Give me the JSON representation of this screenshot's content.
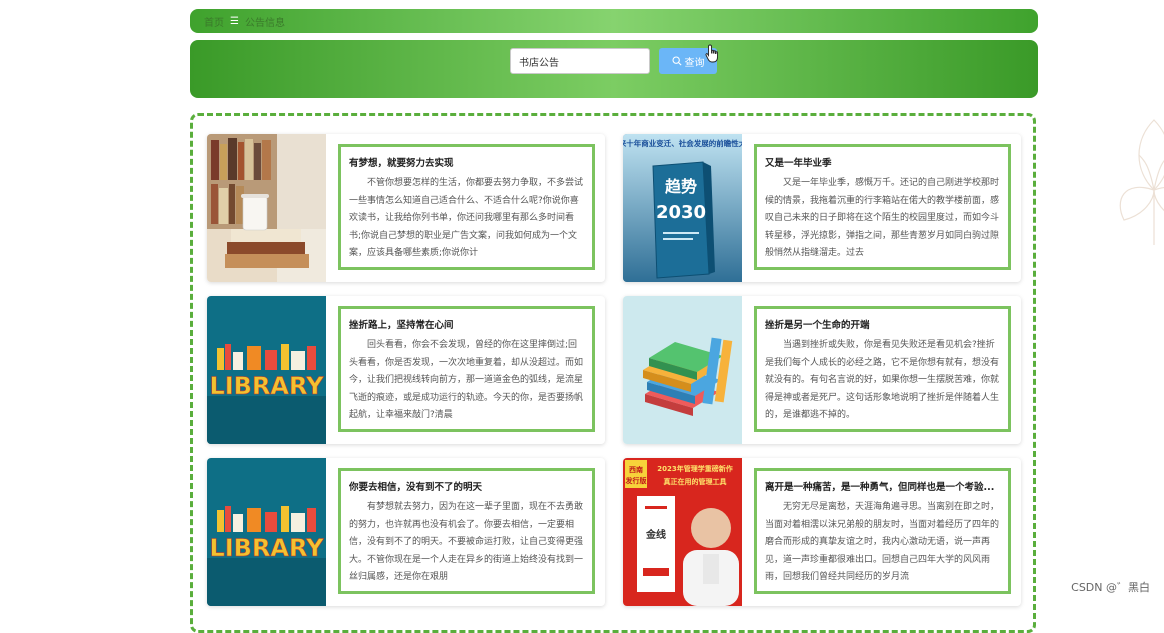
{
  "breadcrumb": {
    "home": "首页",
    "separator": "☰",
    "current": "公告信息"
  },
  "search": {
    "value": "书店公告",
    "button_label": "查询"
  },
  "cards": [
    {
      "title": "有梦想，就要努力去实现",
      "text": "不管你想要怎样的生活，你都要去努力争取，不多尝试一些事情怎么知道自己适合什么、不适合什么呢?你说你喜欢读书，让我给你列书单，你还问我哪里有那么多时间看书;你说自己梦想的职业是广告文案，问我如何成为一个文案，应该具备哪些素质;你说你计",
      "thumb": "books-cup"
    },
    {
      "title": "又是一年毕业季",
      "text": "又是一年毕业季，感慨万千。还记的自己刚进学校那时候的情景，我拖着沉重的行李箱站在偌大的教学楼前面，感叹自己未来的日子即将在这个陌生的校园里度过，而如今斗转星移，浮光掠影，弹指之间，那些青葱岁月如同白驹过隙般悄然从指缝溜走。过去",
      "thumb": "book-cover",
      "cover_top": "未来十年商业变迁、社会发展的前瞻性大作",
      "cover_title": "趋势",
      "cover_year": "2030"
    },
    {
      "title": "挫折路上，坚持常在心间",
      "text": "回头看看，你会不会发现，曾经的你在这里摔倒过;回头看看，你是否发现，一次次地重复着，却从没超过。而如今，让我们把视线转向前方，那一道道金色的弧线，是流星飞逝的痕迹，或是成功运行的轨迹。今天的你，是否要扬帆起航，让幸福来敲门?清晨",
      "thumb": "library",
      "library_word": "LIBRARY"
    },
    {
      "title": "挫折是另一个生命的开端",
      "text": "当遇到挫折或失败，你是看见失败还是看见机会?挫折是我们每个人成长的必经之路，它不是你想有就有，想没有就没有的。有句名言说的好，如果你想一生摆脱苦难，你就得是神或者是死尸。这句话形象地说明了挫折是伴随着人生的，是谁都逃不掉的。",
      "thumb": "book-stack"
    },
    {
      "title": "你要去相信，没有到不了的明天",
      "text": "有梦想就去努力，因为在这一辈子里面，现在不去勇敢的努力，也许就再也没有机会了。你要去相信，一定要相信，没有到不了的明天。不要被命运打败，让自己变得更强大。不管你现在是一个人走在异乡的街道上始终没有找到一丝归属感，还是你在艰朋",
      "thumb": "library",
      "library_word": "LIBRARY"
    },
    {
      "title": "离开是一种痛苦，是一种勇气，但同样也是一个考验...",
      "text": "无穷无尽是离愁，天涯海角遍寻思。当离别在即之时，当面对着相濡以沫兄弟般的朋友时，当面对着经历了四年的磨合而形成的真挚友谊之时，我内心激动无语，说一声再见，道一声珍重都很难出口。回想自己四年大学的风风雨雨，回想我们曾经共同经历的岁月流",
      "thumb": "person-cover",
      "cover_badge_top": "西南",
      "cover_badge_bottom": "发行版",
      "cover_headline_1": "2023年管理学重磅新作",
      "cover_headline_2": "真正在用的管理工具",
      "cover_book_title": "金线"
    }
  ],
  "watermark": "CSDN @゛黑白"
}
